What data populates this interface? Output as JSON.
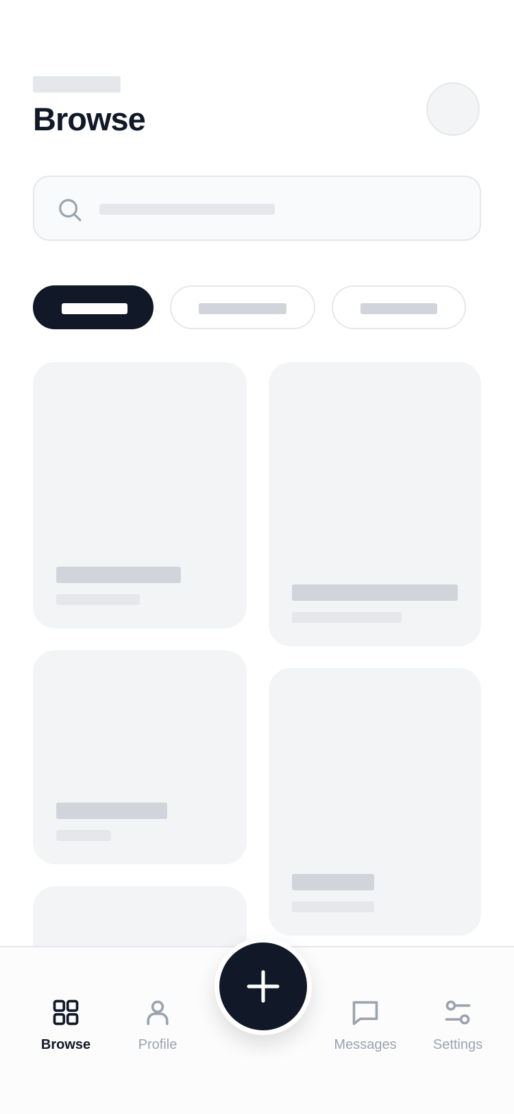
{
  "header": {
    "title": "Browse"
  },
  "bottom_nav": {
    "items": [
      {
        "label": "Browse",
        "icon": "grid-icon",
        "active": true
      },
      {
        "label": "Profile",
        "icon": "user-icon",
        "active": false
      },
      {
        "label": "Messages",
        "icon": "message-icon",
        "active": false
      },
      {
        "label": "Settings",
        "icon": "sliders-icon",
        "active": false
      }
    ],
    "fab_icon": "plus-icon"
  },
  "colors": {
    "primary": "#111827",
    "skeleton_light": "#e5e7eb",
    "skeleton_mid": "#d1d5db",
    "card_background": "#f3f4f6",
    "inactive_text": "#9ca3af"
  }
}
